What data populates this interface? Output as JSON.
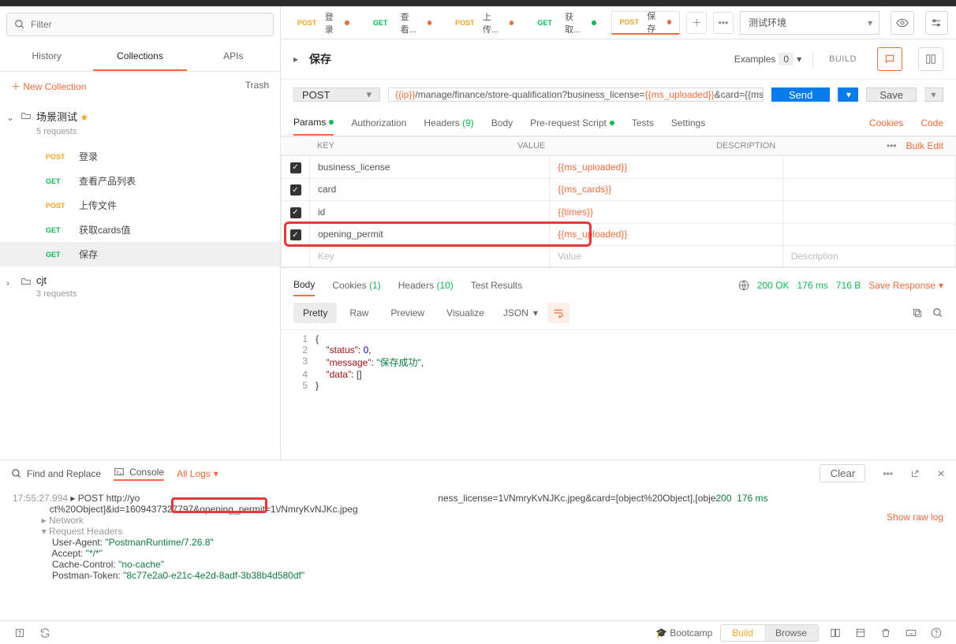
{
  "sidebar": {
    "filter_placeholder": "Filter",
    "tabs": {
      "history": "History",
      "collections": "Collections",
      "apis": "APIs"
    },
    "new_collection": "New Collection",
    "trash": "Trash",
    "collections": [
      {
        "name": "场景测试",
        "starred": true,
        "sub": "5 requests",
        "items": [
          {
            "method": "POST",
            "name": "登录"
          },
          {
            "method": "GET",
            "name": "查看产品列表"
          },
          {
            "method": "POST",
            "name": "上传文件"
          },
          {
            "method": "GET",
            "name": "获取cards值"
          },
          {
            "method": "GET",
            "name": "保存",
            "active": true
          }
        ]
      },
      {
        "name": "cjt",
        "sub": "3 requests"
      }
    ]
  },
  "tabs": [
    {
      "method": "POST",
      "label": "登录",
      "dot": "orange"
    },
    {
      "method": "GET",
      "label": "查看...",
      "dot": "orange"
    },
    {
      "method": "POST",
      "label": "上传...",
      "dot": "orange"
    },
    {
      "method": "GET",
      "label": "获取...",
      "dot": "green"
    },
    {
      "method": "POST",
      "label": "保存",
      "dot": "orange",
      "active": true
    }
  ],
  "env": "测试环境",
  "request": {
    "title": "保存",
    "examples_label": "Examples",
    "examples_count": "0",
    "build": "BUILD",
    "method": "POST",
    "url_prefix": "{{ip}}",
    "url_path": "/manage/finance/store-qualification?business_license=",
    "url_var2": "{{ms_uploaded}}",
    "url_tail": "&card={{ms",
    "send": "Send",
    "save": "Save"
  },
  "req_tabs": {
    "params": "Params",
    "auth": "Authorization",
    "headers": "Headers",
    "headers_n": "(9)",
    "body": "Body",
    "prs": "Pre-request Script",
    "tests": "Tests",
    "settings": "Settings",
    "cookies": "Cookies",
    "code": "Code"
  },
  "param_cols": {
    "key": "KEY",
    "value": "VALUE",
    "desc": "DESCRIPTION",
    "bulk": "Bulk Edit"
  },
  "params": [
    {
      "key": "business_license",
      "value": "{{ms_uploaded}}"
    },
    {
      "key": "card",
      "value": "{{ms_cards}}"
    },
    {
      "key": "id",
      "value": "{{times}}",
      "highlight": true
    },
    {
      "key": "opening_permit",
      "value": "{{ms_uploaded}}"
    }
  ],
  "param_placeholder": {
    "key": "Key",
    "value": "Value",
    "desc": "Description"
  },
  "resp_tabs": {
    "body": "Body",
    "cookies": "Cookies",
    "cookies_n": "(1)",
    "headers": "Headers",
    "headers_n": "(10)",
    "tests": "Test Results"
  },
  "resp_meta": {
    "status": "200 OK",
    "time": "176 ms",
    "size": "716 B",
    "save": "Save Response"
  },
  "view": {
    "pretty": "Pretty",
    "raw": "Raw",
    "preview": "Preview",
    "visualize": "Visualize",
    "type": "JSON"
  },
  "response_json": {
    "lines": [
      "{",
      "    \"status\": 0,",
      "    \"message\": \"保存成功\",",
      "    \"data\": []",
      "}"
    ]
  },
  "bottombar": {
    "find": "Find and Replace",
    "console": "Console",
    "all_logs": "All Logs",
    "clear": "Clear"
  },
  "console": {
    "ts": "17:55:27.994",
    "l1a": "POST http://yo",
    "l1b": "ness_license=1\\/NmryKvNJKc.jpeg&card=[object%20Object],[obje",
    "l1status": "200",
    "l1time": "176 ms",
    "l2a": "ct%20Object]",
    "l2b": "&id=1609437327797",
    "l2c": "&opening_permit=1\\/NmryKvNJKc.jpeg",
    "net": "Network",
    "reqh": "Request Headers",
    "h1k": "User-Agent:",
    "h1v": "\"PostmanRuntime/7.26.8\"",
    "h2k": "Accept:",
    "h2v": "\"*/*\"",
    "h3k": "Cache-Control:",
    "h3v": "\"no-cache\"",
    "h4k": "Postman-Token:",
    "h4v": "\"8c77e2a0-e21c-4e2d-8adf-3b38b4d580df\"",
    "show_raw": "Show raw log"
  },
  "statusbar": {
    "bootcamp": "Bootcamp",
    "build": "Build",
    "browse": "Browse"
  }
}
